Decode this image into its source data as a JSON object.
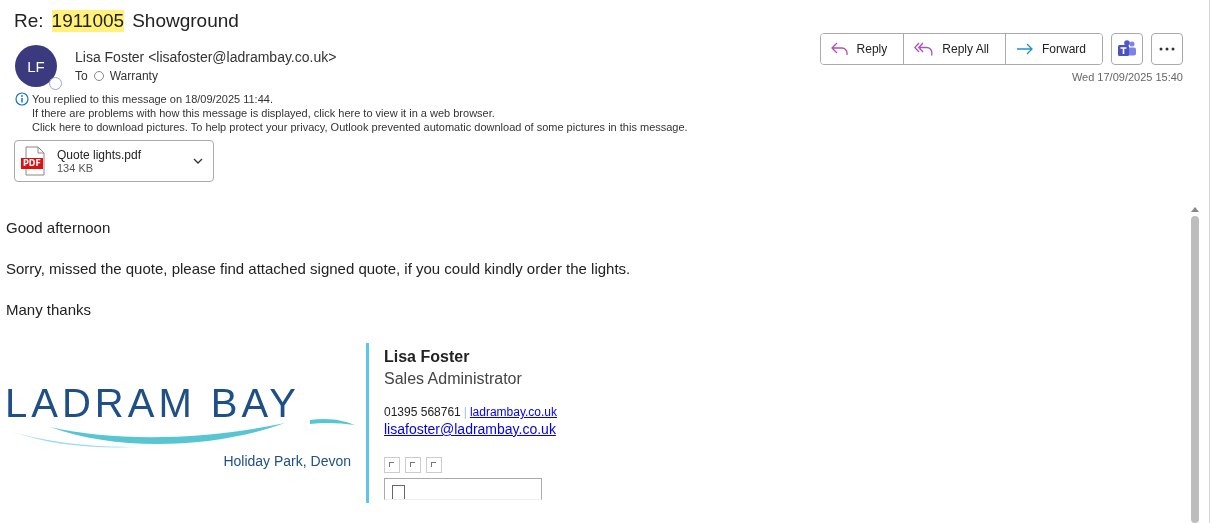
{
  "subject": {
    "prefix": "Re:",
    "highlight": "1911005",
    "rest": "Showground"
  },
  "sender": {
    "initials": "LF",
    "name": "Lisa Foster <lisafoster@ladrambay.co.uk>",
    "to_label": "To",
    "recipient": "Warranty"
  },
  "actions": [
    {
      "label": "Reply",
      "kind": "reply"
    },
    {
      "label": "Reply All",
      "kind": "reply-all"
    },
    {
      "label": "Forward",
      "kind": "forward"
    }
  ],
  "date": "Wed 17/09/2025 15:40",
  "info": [
    "You replied to this message on 18/09/2025 11:44.",
    "If there are problems with how this message is displayed, click here to view it in a web browser.",
    "Click here to download pictures. To help protect your privacy, Outlook prevented automatic download of some pictures in this message."
  ],
  "attachment": {
    "name": "Quote lights.pdf",
    "size": "134 KB",
    "badge": "PDF"
  },
  "body": [
    "Good afternoon",
    "Sorry, missed the quote, please find attached signed quote, if you could kindly order the lights.",
    "Many thanks"
  ],
  "signature": {
    "logo_name": "LADRAM BAY",
    "logo_tagline": "Holiday Park, Devon",
    "name": "Lisa Foster",
    "title": "Sales Administrator",
    "phone": "01395 568761",
    "separator": "|",
    "website": "ladrambay.co.uk",
    "email": "lisafoster@ladrambay.co.uk"
  }
}
